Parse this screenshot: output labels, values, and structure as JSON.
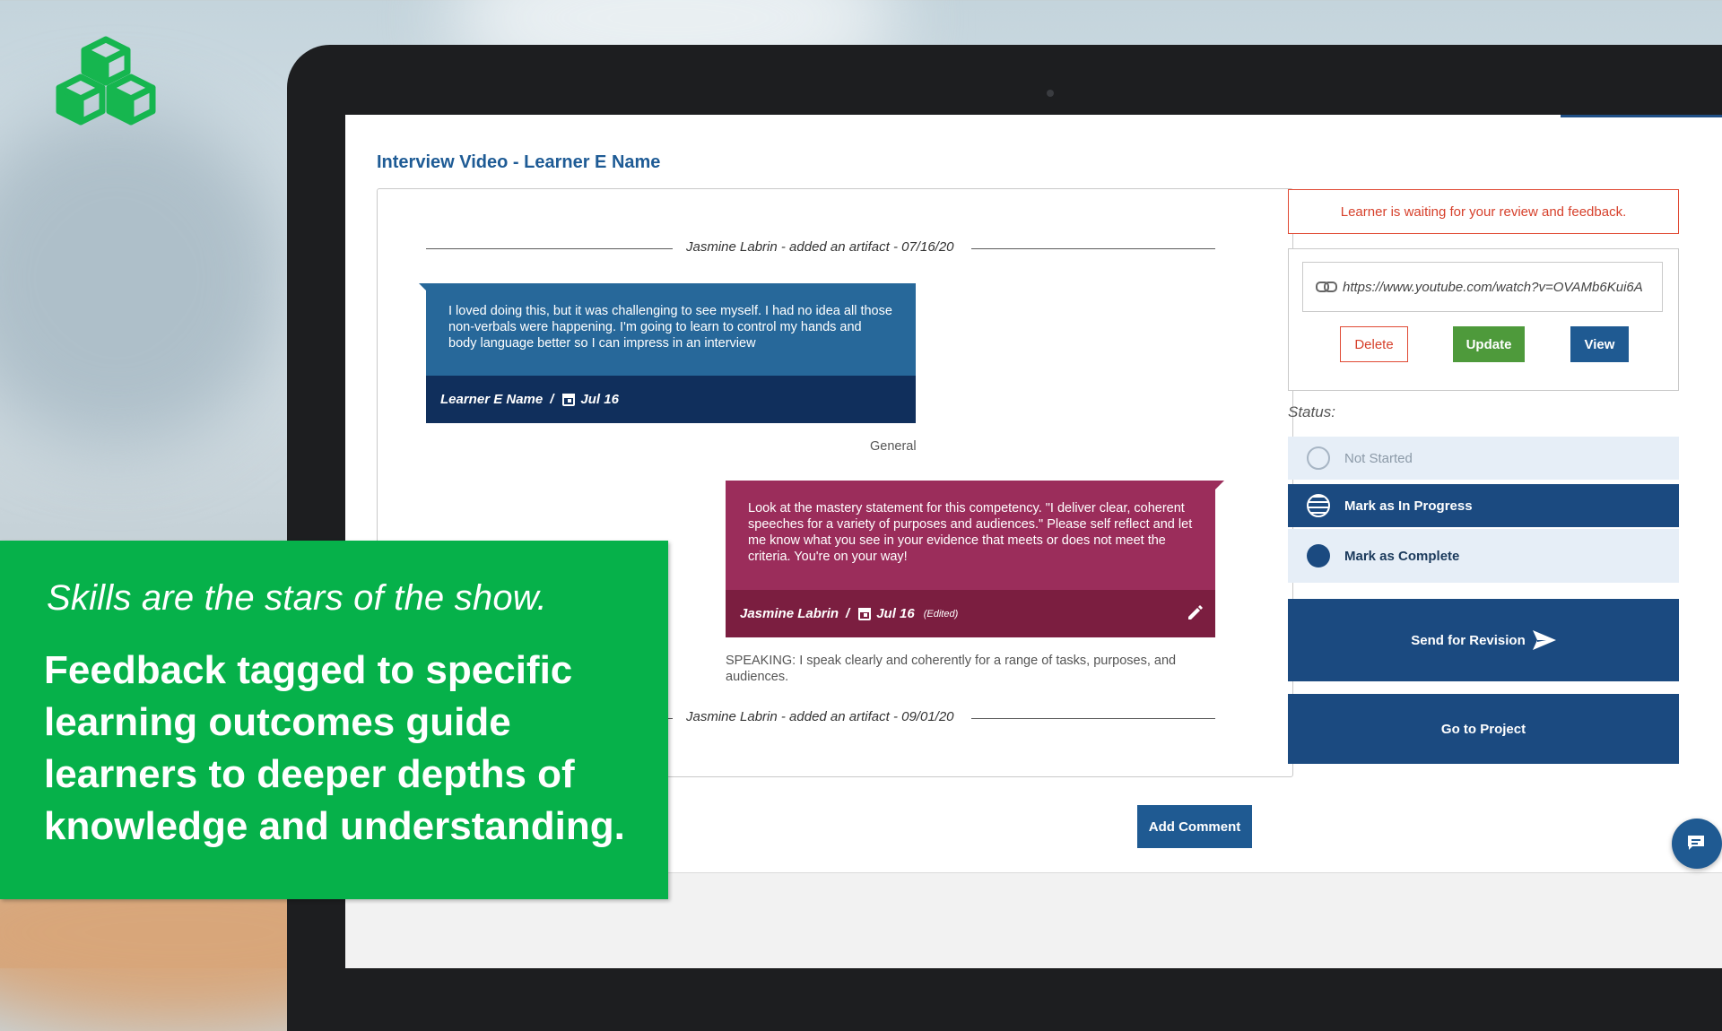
{
  "page": {
    "title": "Interview Video - Learner E Name"
  },
  "feed": {
    "dividers": [
      "Jasmine Labrin - added an artifact - 07/16/20",
      "Jasmine Labrin - added an artifact - 09/01/20"
    ],
    "messages": [
      {
        "text": "I loved doing this, but it was challenging to see myself. I had no idea all those non-verbals were happening. I'm going to learn to control my hands and body language better so I can impress in an interview",
        "author": "Learner E Name",
        "separator": "/",
        "date": "Jul 16",
        "tag": "General"
      },
      {
        "text": "Look at the mastery statement for this competency. \"I deliver clear, coherent speeches for a variety of purposes and audiences.\" Please self reflect and let me know what you see in your evidence that meets or does not meet the criteria. You're on your way!",
        "author": "Jasmine Labrin",
        "separator": "/",
        "date": "Jul 16",
        "edited": "(Edited)",
        "tag": "SPEAKING: I speak clearly and coherently for a range of tasks, purposes, and audiences."
      }
    ],
    "add_comment_label": "Add Comment"
  },
  "review": {
    "alert": "Learner is waiting for your review and feedback.",
    "url": "https://www.youtube.com/watch?v=OVAMb6Kui6A",
    "delete_label": "Delete",
    "update_label": "Update",
    "view_label": "View",
    "status_label": "Status:",
    "status_options": [
      "Not Started",
      "Mark as In Progress",
      "Mark as Complete"
    ],
    "send_label": "Send for Revision",
    "goto_label": "Go to Project"
  },
  "promo": {
    "tagline": "Skills are the stars of the show.",
    "headline": "Feedback tagged to specific learning outcomes guide learners to deeper depths of knowledge and understanding."
  },
  "colors": {
    "promo_green": "#06b14a",
    "primary_blue": "#1f5a92",
    "learner_bubble": "#27689a",
    "teacher_bubble": "#9b2d5b",
    "alert_red": "#d6402b",
    "update_green": "#4e9a3b"
  },
  "icons": [
    "cubes-logo-icon",
    "calendar-icon",
    "pencil-icon",
    "link-icon",
    "send-icon",
    "chat-icon"
  ]
}
